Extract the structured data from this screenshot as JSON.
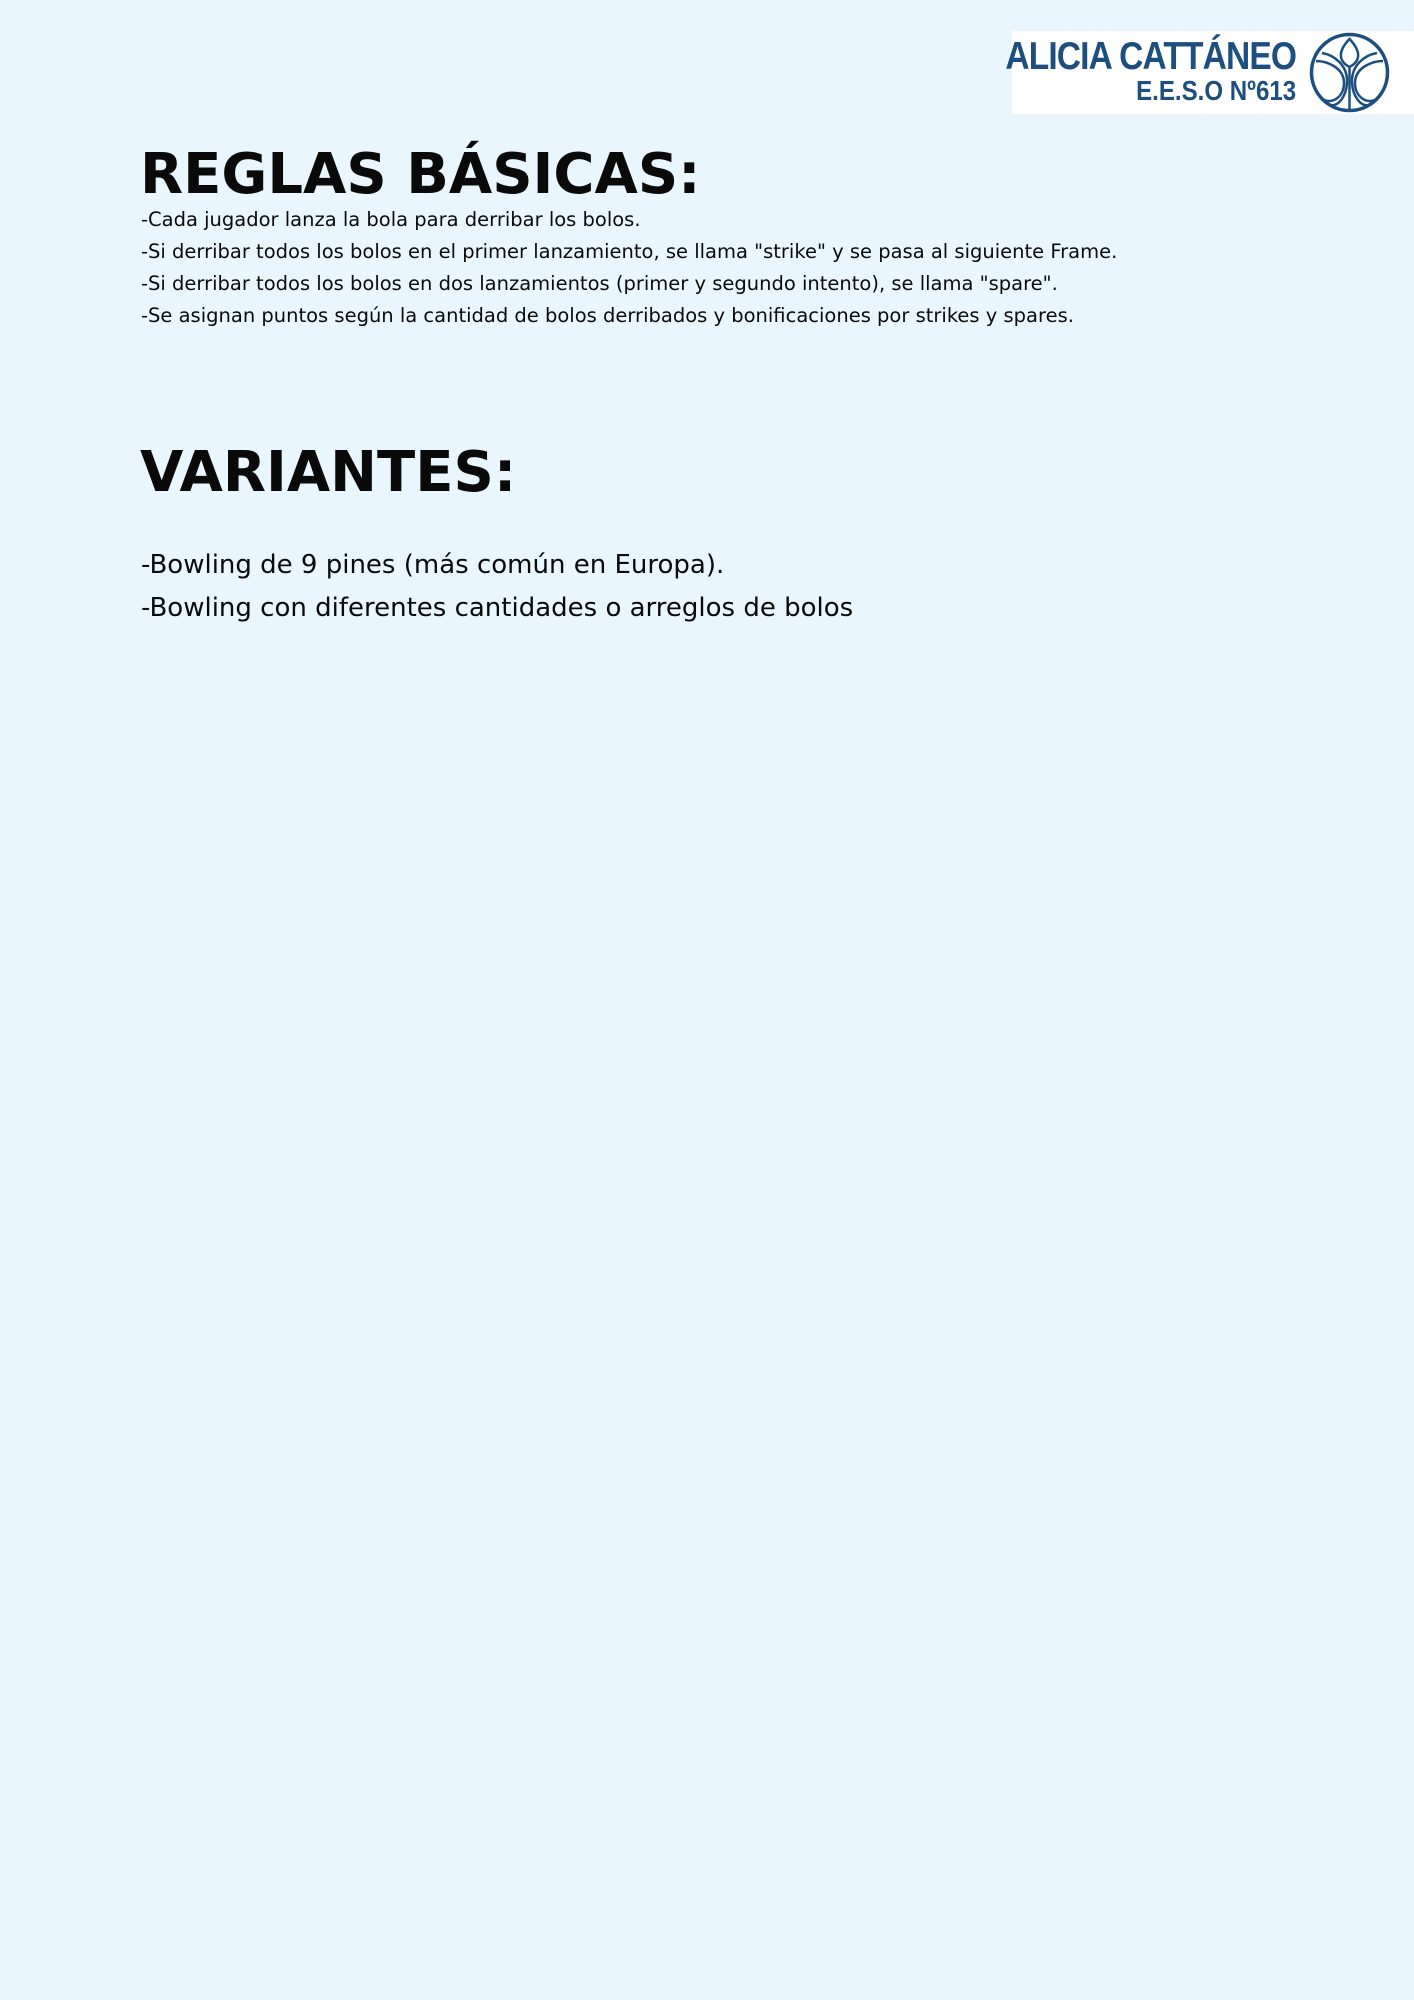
{
  "logo": {
    "name": "ALICIA CATTÁNEO",
    "subtitle": "E.E.S.O  Nº613",
    "emblem_icon": "school-emblem-icon",
    "brand_color": "#1c4f80"
  },
  "page": {
    "background_color": "#e9f6fe"
  },
  "basic_rules": {
    "title": "REGLAS BÁSICAS:",
    "items": [
      "-Cada jugador lanza la bola para derribar los bolos.",
      "-Si derribar todos los bolos en el primer lanzamiento, se llama \"strike\" y se pasa al siguiente Frame.",
      "-Si derribar todos los bolos en dos lanzamientos (primer y segundo intento), se llama \"spare\".",
      "-Se asignan puntos según la cantidad de bolos derribados y bonificaciones por strikes y spares."
    ]
  },
  "variants": {
    "title": "VARIANTES:",
    "items": [
      "-Bowling de 9 pines (más común en Europa).",
      "-Bowling con diferentes cantidades o arreglos de bolos"
    ]
  }
}
